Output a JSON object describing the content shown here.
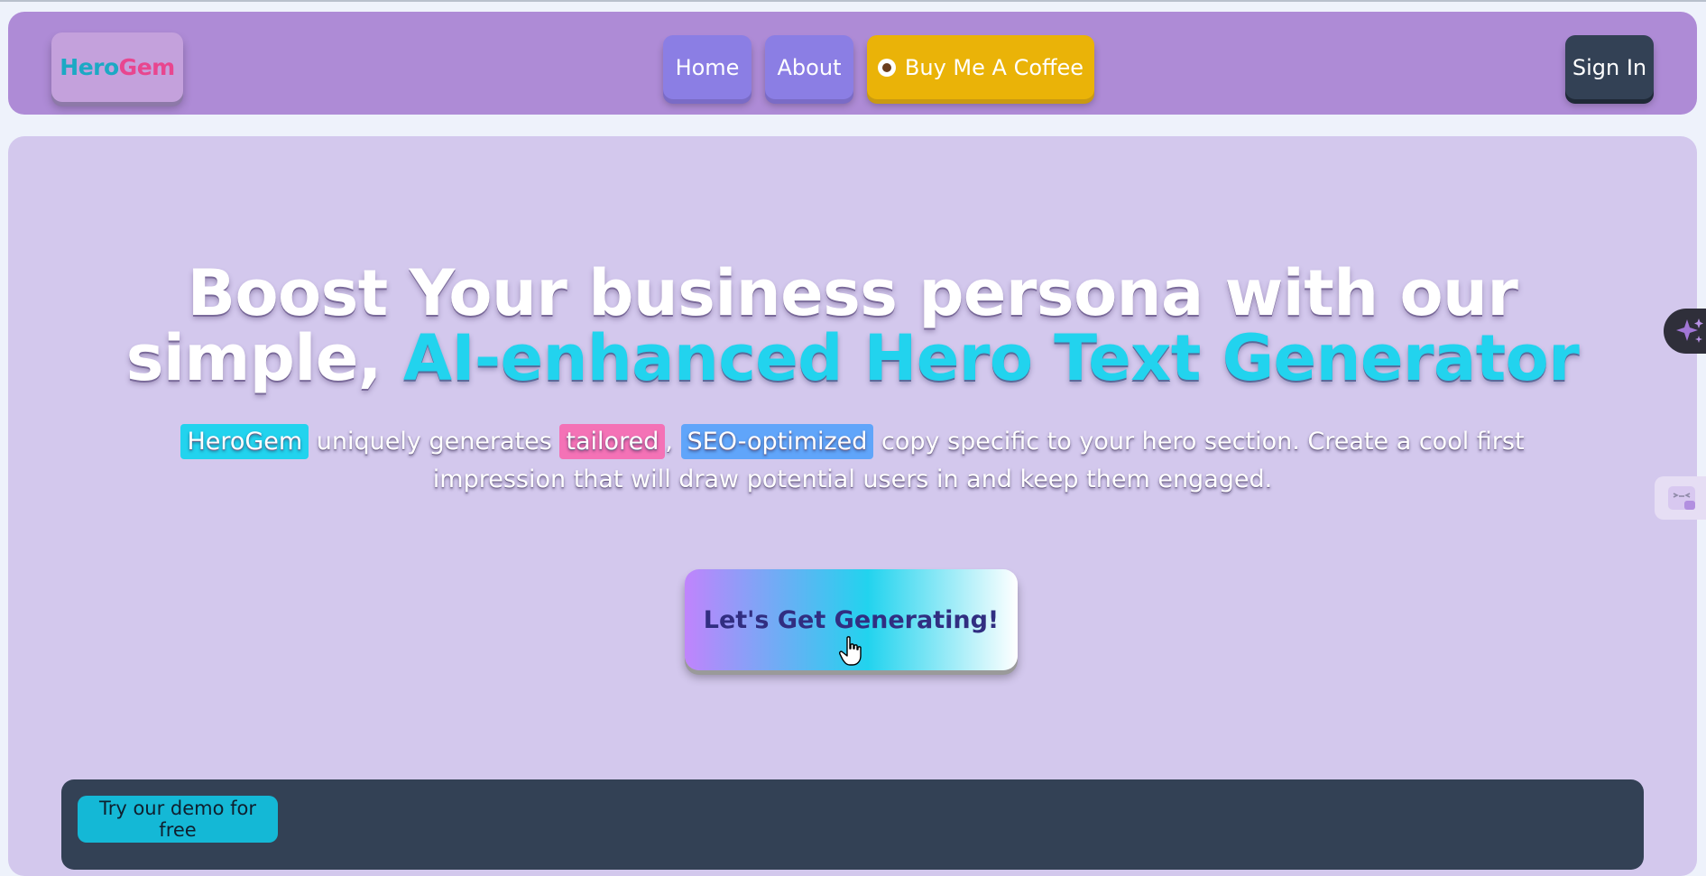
{
  "nav": {
    "logo_part1": "Hero",
    "logo_part2": "Gem",
    "home_label": "Home",
    "about_label": "About",
    "coffee_label": "Buy Me A Coffee",
    "signin_label": "Sign In"
  },
  "hero": {
    "headline_line1": "Boost Your business persona with our",
    "headline_line2_plain": "simple, ",
    "headline_line2_accent": "AI-enhanced Hero Text Generator",
    "sub_tag1": "HeroGem",
    "sub_text1": " uniquely generates ",
    "sub_tag2": "tailored",
    "sub_text2": ", ",
    "sub_tag3": "SEO-optimized",
    "sub_text3": " copy specific to your hero section. Create a cool first impression that will draw potential users in and keep them engaged.",
    "cta_label": "Let's Get Generating!"
  },
  "demo": {
    "button_label": "Try our demo for free"
  },
  "icons": {
    "coffee": "coffee-cup-icon",
    "sparkle": "sparkle-icon",
    "cursor": "hand-pointer-cursor-icon",
    "mini_widget": "face-icon"
  },
  "colors": {
    "navbar": "#ae8bd6",
    "hero_bg": "#d3c8ed",
    "accent_cyan": "#22d3ee",
    "accent_pink": "#f472b6",
    "accent_blue": "#60a5fa",
    "coffee_yellow": "#eab308",
    "dark_slate": "#334155"
  }
}
